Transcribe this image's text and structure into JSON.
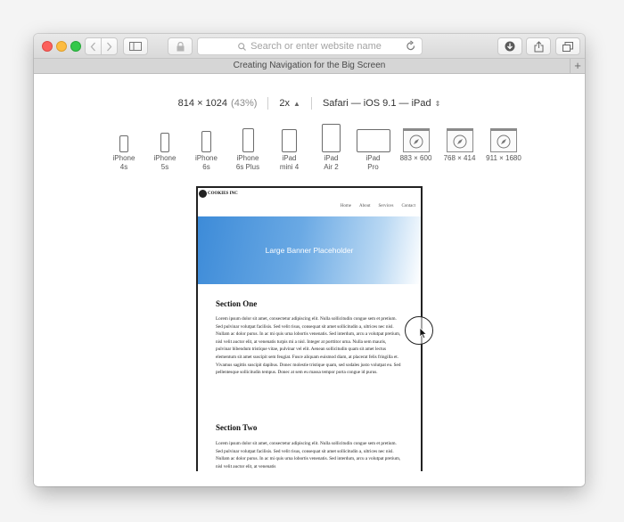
{
  "toolbar": {
    "back_icon": "chevron-left-icon",
    "forward_icon": "chevron-right-icon",
    "address_placeholder": "Search or enter website name",
    "reload_icon": "reload-icon"
  },
  "tab": {
    "title": "Creating Navigation for the Big Screen",
    "new_tab_label": "+"
  },
  "responsive": {
    "dimensions": "814 × 1024",
    "zoom": "(43%)",
    "scale": "2x",
    "user_agent": "Safari — iOS 9.1 — iPad",
    "devices": [
      {
        "name": "iPhone\n4s"
      },
      {
        "name": "iPhone\n5s"
      },
      {
        "name": "iPhone\n6s"
      },
      {
        "name": "iPhone\n6s Plus"
      },
      {
        "name": "iPad\nmini 4"
      },
      {
        "name": "iPad\nAir 2"
      },
      {
        "name": "iPad\nPro"
      },
      {
        "name": "883 × 600"
      },
      {
        "name": "768 × 414"
      },
      {
        "name": "911 × 1680"
      }
    ]
  },
  "site": {
    "logo": "COOKIES INC",
    "nav": [
      "Home",
      "About",
      "Services",
      "Contact"
    ],
    "banner": "Large Banner Placeholder",
    "section_one": {
      "title": "Section One",
      "body": "Lorem ipsum dolor sit amet, consectetur adipiscing elit. Nulla sollicitudin congue sem et pretium. Sed pulvinar volutpat facilisis. Sed velit risus, consequat sit amet sollicitudin a, ultrices nec nisl. Nullam ac dolor purus. In ac mi quis urna lobortis venenatis. Sed interdum, arcu a volutpat pretium, nisl velit auctor elit, at venenatis turpis mi a nisl. Integer at porttitor urna. Nulla sem mauris, pulvinar bibendum tristique vitae, pulvinar vel elit. Aenean sollicitudin quam sit amet lectus elementum sit amet suscipit sem feugiat. Fusce aliquam euismod diam, at placerat felis fringilla et. Vivamus sagittis suscipit dapibus. Donec molestie tristique quam, sed sodales justo volutpat eu. Sed pellentesque sollicitudin tempus. Donec at sem eu massa tempor porta congue id purus."
    },
    "section_two": {
      "title": "Section Two",
      "body": "Lorem ipsum dolor sit amet, consectetur adipiscing elit. Nulla sollicitudin congue sem et pretium. Sed pulvinar volutpat facilisis. Sed velit risus, consequat sit amet sollicitudin a, ultrices nec nisl. Nullam ac dolor purus. In ac mi quis urna lobortis venenatis. Sed interdum, arcu a volutpat pretium, nisl velit auctor elit, at venenatis"
    }
  }
}
